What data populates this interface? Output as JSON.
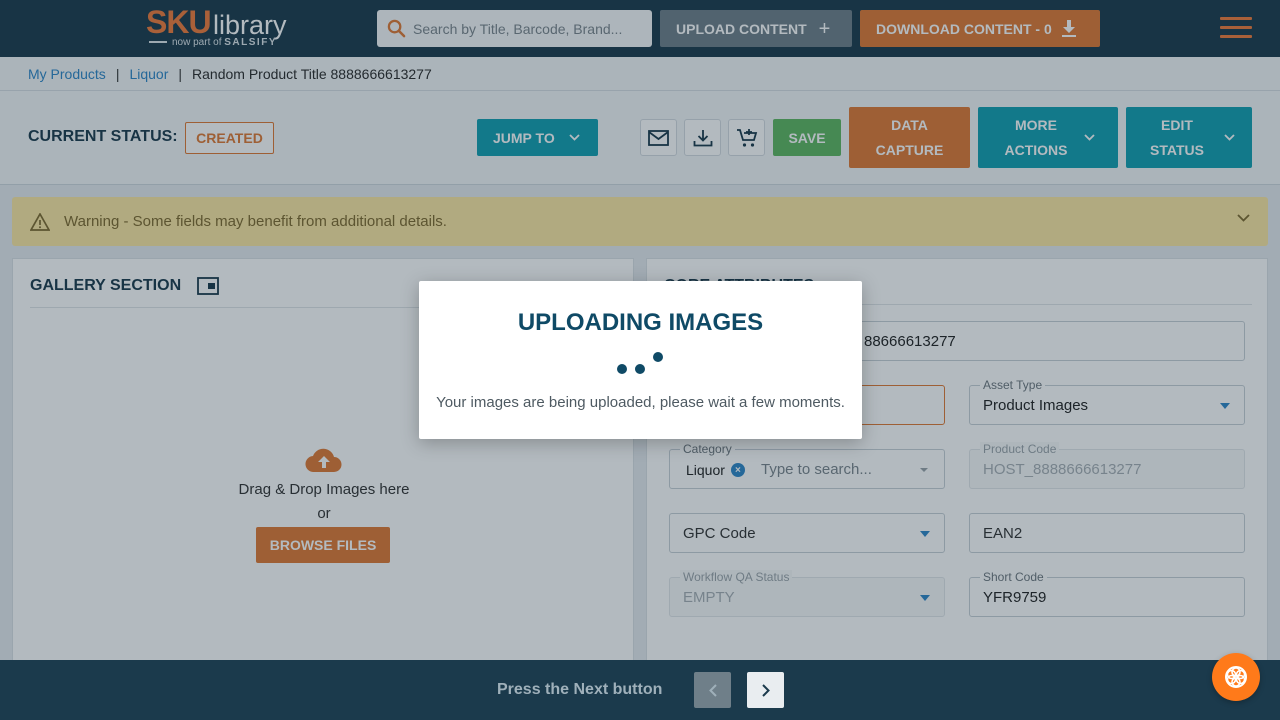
{
  "header": {
    "logo_sku": "SKU",
    "logo_library": "library",
    "logo_tagline_prefix": "now part of",
    "logo_tagline_brand": "SALSIFY",
    "search_placeholder": "Search by Title, Barcode, Brand...",
    "upload_label": "UPLOAD CONTENT",
    "upload_icon": "plus-icon",
    "download_label": "DOWNLOAD CONTENT - 0",
    "download_icon": "download-icon",
    "menu_icon": "hamburger-icon"
  },
  "breadcrumb": {
    "items": [
      "My Products",
      "Liquor",
      "Random Product Title 8888666613277"
    ],
    "separator": "|"
  },
  "status": {
    "label": "CURRENT STATUS:",
    "value": "CREATED",
    "jump_label": "JUMP TO",
    "save_label": "SAVE",
    "data_capture_label": "DATA CAPTURE",
    "more_actions_label": "MORE ACTIONS",
    "edit_status_label": "EDIT STATUS",
    "icon_buttons": [
      "email-icon",
      "download-icon",
      "add-to-cart-icon"
    ]
  },
  "warning": {
    "text": "Warning - Some fields may benefit from additional details."
  },
  "gallery": {
    "title": "GALLERY SECTION",
    "drop_text": "Drag & Drop Images here",
    "or_text": "or",
    "browse_label": "BROWSE FILES"
  },
  "core": {
    "title": "CORE ATTRIBUTES",
    "title_value_partial": "88666613277",
    "fields": {
      "asset_type": {
        "label": "Asset Type",
        "value": "Product Images"
      },
      "category": {
        "label": "Category",
        "chip": "Liquor",
        "placeholder": "Type to search..."
      },
      "product_code": {
        "label": "Product Code",
        "value": "HOST_8888666613277"
      },
      "gpc_code": {
        "placeholder": "GPC Code"
      },
      "ean2": {
        "placeholder": "EAN2"
      },
      "workflow_qa": {
        "label": "Workflow QA Status",
        "value": "EMPTY"
      },
      "short_code": {
        "label": "Short Code",
        "value": "YFR9759"
      }
    }
  },
  "modal": {
    "title": "UPLOADING IMAGES",
    "message": "Your images are being uploaded, please wait a few moments."
  },
  "footer": {
    "instruction": "Press the Next button"
  },
  "colors": {
    "header_bg": "#1b3a4c",
    "accent_orange": "#e07a34",
    "accent_teal": "#139fb2",
    "save_green": "#5fb760",
    "warning_bg": "#fde7a3",
    "modal_title": "#0f4a66"
  }
}
